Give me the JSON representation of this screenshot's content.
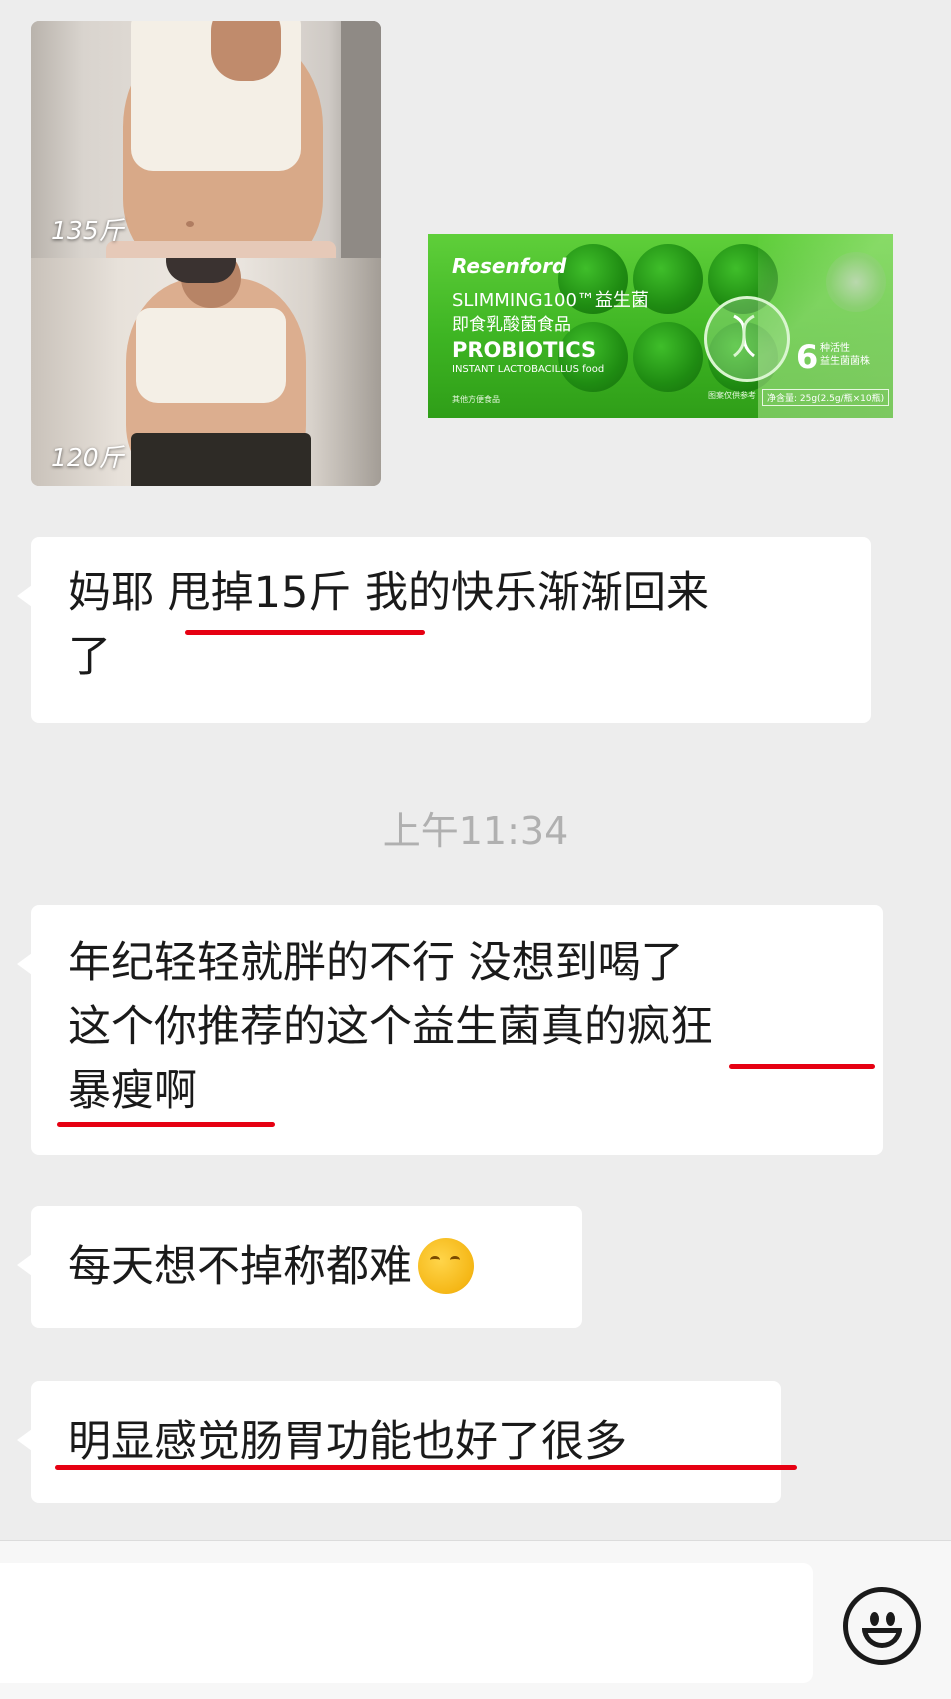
{
  "images": {
    "before_after": {
      "before_label": "135斤",
      "after_label": "120斤"
    },
    "product": {
      "brand": "Resenford",
      "line1": "SLIMMING100™益生菌",
      "line2": "即食乳酸菌食品",
      "line3": "PROBIOTICS",
      "line4": "INSTANT LACTOBACILLUS food",
      "count": "6",
      "count_sub1": "种活性",
      "count_sub2": "益生菌菌株",
      "net": "净含量: 25g(2.5g/瓶×10瓶)",
      "note": "图案仅供参考",
      "category": "其他方便食品",
      "colors": {
        "box": "#3eb523",
        "text": "#ffffff"
      }
    }
  },
  "messages": [
    {
      "line1": "妈耶 甩掉15斤 我的快乐渐渐回来",
      "line2": "了"
    },
    {
      "line1": "年纪轻轻就胖的不行 没想到喝了",
      "line2": "这个你推荐的这个益生菌真的疯狂",
      "line3": "暴瘦啊"
    },
    {
      "line1": "每天想不掉称都难",
      "emoji": "thinking-face"
    },
    {
      "line1": "明显感觉肠胃功能也好了很多"
    }
  ],
  "timestamp": "上午11:34",
  "input_bar": {
    "placeholder": "",
    "emoji_icon": "smiley-face"
  },
  "colors": {
    "background": "#ededed",
    "bubble": "#ffffff",
    "highlight_underline": "#e60012",
    "timestamp": "#b0b0b0"
  }
}
